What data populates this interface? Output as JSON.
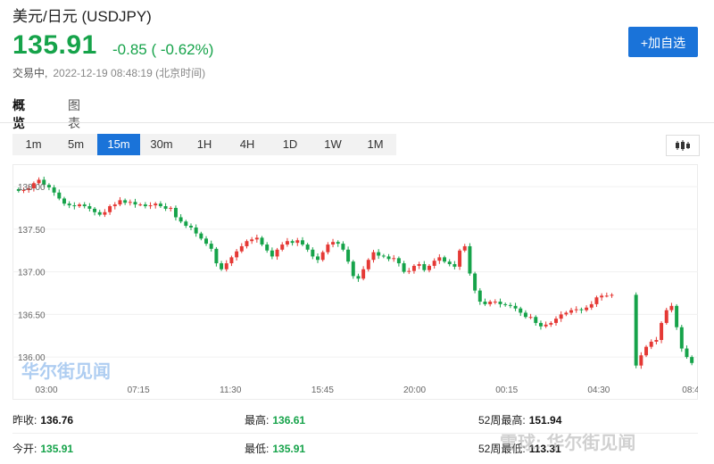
{
  "header": {
    "title": "美元/日元 (USDJPY)",
    "price": "135.91",
    "change": "-0.85 ( -0.62%)",
    "status": "交易中,",
    "timestamp": "2022-12-19 08:48:19 (北京时间)",
    "watch_button": "+加自选"
  },
  "tabs": [
    "概览",
    "图表"
  ],
  "intervals": [
    "1m",
    "5m",
    "15m",
    "30m",
    "1H",
    "4H",
    "1D",
    "1W",
    "1M"
  ],
  "active_interval": "15m",
  "chart_data": {
    "type": "candlestick",
    "y_ticks": [
      "138.00",
      "137.50",
      "137.00",
      "136.50",
      "136.00"
    ],
    "x_ticks": [
      "03:00",
      "07:15",
      "11:30",
      "15:45",
      "20:00",
      "00:15",
      "04:30",
      "08:4"
    ],
    "ylim": [
      135.75,
      138.2
    ],
    "colors": {
      "up": "#e53935",
      "down": "#16a34a"
    },
    "closes": [
      137.95,
      137.96,
      137.98,
      138.04,
      138.08,
      138.02,
      137.99,
      137.93,
      137.86,
      137.8,
      137.78,
      137.77,
      137.79,
      137.77,
      137.74,
      137.7,
      137.67,
      137.7,
      137.77,
      137.79,
      137.84,
      137.81,
      137.82,
      137.79,
      137.79,
      137.77,
      137.78,
      137.8,
      137.77,
      137.74,
      137.75,
      137.64,
      137.59,
      137.54,
      137.52,
      137.45,
      137.39,
      137.33,
      137.27,
      137.1,
      137.03,
      137.1,
      137.17,
      137.24,
      137.3,
      137.36,
      137.38,
      137.4,
      137.32,
      137.25,
      137.18,
      137.26,
      137.32,
      137.36,
      137.34,
      137.37,
      137.32,
      137.26,
      137.18,
      137.14,
      137.23,
      137.32,
      137.35,
      137.33,
      137.26,
      137.12,
      136.95,
      136.92,
      137.03,
      137.14,
      137.23,
      137.19,
      137.18,
      137.15,
      137.16,
      137.1,
      137.0,
      137.01,
      137.07,
      137.09,
      137.02,
      137.07,
      137.13,
      137.17,
      137.12,
      137.09,
      137.06,
      137.25,
      137.3,
      136.98,
      136.78,
      136.65,
      136.62,
      136.65,
      136.65,
      136.62,
      136.61,
      136.6,
      136.57,
      136.52,
      136.47,
      136.47,
      136.4,
      136.36,
      136.38,
      136.4,
      136.45,
      136.5,
      136.52,
      136.55,
      136.56,
      136.55,
      136.58,
      136.62,
      136.7,
      136.72,
      136.72,
      136.73,
      135.9,
      136.02,
      136.12,
      136.18,
      136.2,
      136.4,
      136.55,
      136.6,
      136.35,
      136.1,
      136.0,
      135.93
    ],
    "gaps": [
      {
        "after": 117,
        "width": 0.028
      }
    ]
  },
  "stats": {
    "prev_close_label": "昨收:",
    "prev_close": "136.76",
    "open_label": "今开:",
    "open": "135.91",
    "high_label": "最高:",
    "high": "136.61",
    "low_label": "最低:",
    "low": "135.91",
    "w52_high_label": "52周最高:",
    "w52_high": "151.94",
    "w52_low_label": "52周最低:",
    "w52_low": "113.31"
  },
  "watermark": "华尔街见闻",
  "watermark2": "雪球: 华尔街见闻"
}
